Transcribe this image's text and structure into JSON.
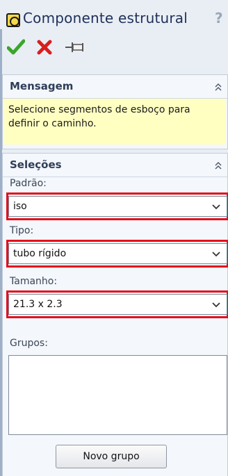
{
  "window": {
    "title": "Componente estrutural",
    "help_label": "?"
  },
  "toolbar": {
    "ok_icon": "checkmark-icon",
    "cancel_icon": "close-icon",
    "pin_icon": "pushpin-icon"
  },
  "message_group": {
    "title": "Mensagem",
    "text": "Selecione segmentos de esboço para definir o caminho."
  },
  "selections_group": {
    "title": "Seleções",
    "standard": {
      "label": "Padrão:",
      "value": "iso"
    },
    "type": {
      "label": "Tipo:",
      "value": "tubo rígido"
    },
    "size": {
      "label": "Tamanho:",
      "value": "21.3 x 2.3"
    },
    "groups": {
      "label": "Grupos:",
      "items": []
    },
    "new_group_label": "Novo grupo"
  },
  "colors": {
    "highlight": "#e3101c",
    "message_bg": "#ffffc2",
    "ok": "#3aa62a",
    "cancel": "#d81e1e"
  }
}
